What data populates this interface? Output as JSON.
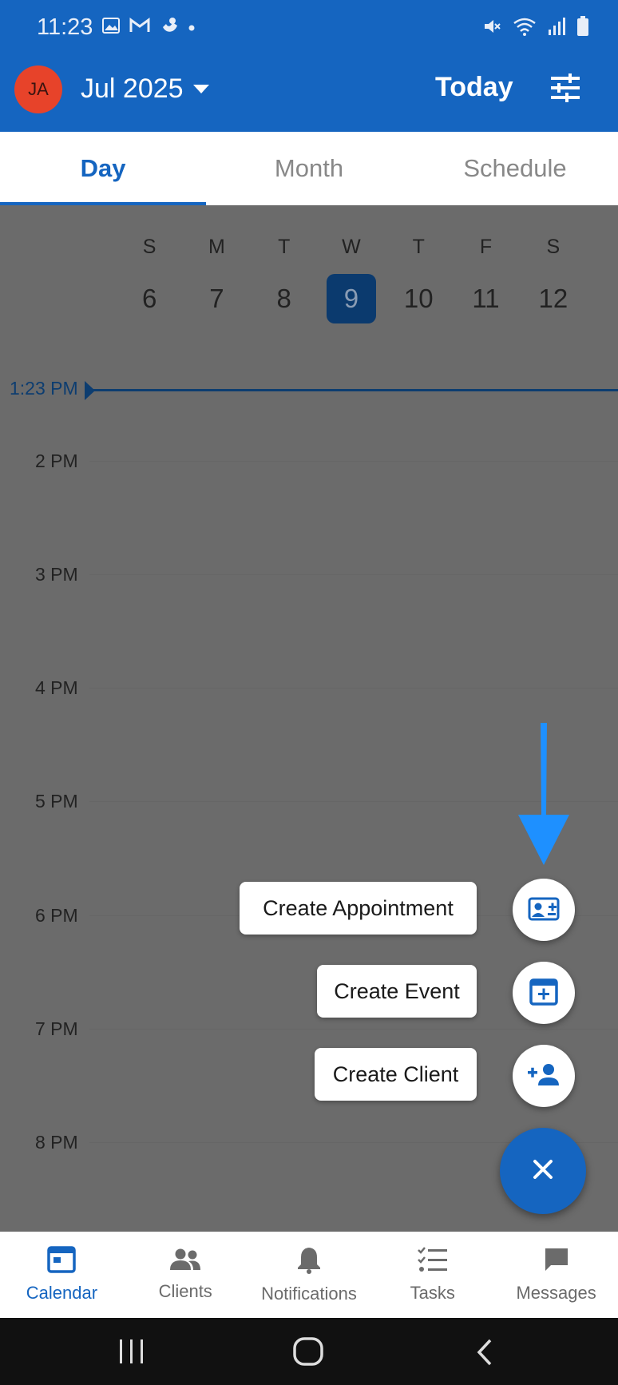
{
  "status_bar": {
    "time": "11:23",
    "left_icons": [
      "image-icon",
      "gmail-icon",
      "phone-icon",
      "dot-icon"
    ],
    "right_icons": [
      "mute-icon",
      "wifi-icon",
      "signal-icon",
      "battery-icon"
    ]
  },
  "header": {
    "avatar_initials": "JA",
    "month": "Jul 2025",
    "today_label": "Today",
    "filter_icon": "tune-icon",
    "accent_color": "#1565c0"
  },
  "tabs": [
    {
      "label": "Day",
      "active": true
    },
    {
      "label": "Month",
      "active": false
    },
    {
      "label": "Schedule",
      "active": false
    }
  ],
  "week": [
    {
      "letter": "S",
      "day": "6"
    },
    {
      "letter": "M",
      "day": "7"
    },
    {
      "letter": "T",
      "day": "8"
    },
    {
      "letter": "W",
      "day": "9",
      "selected": true
    },
    {
      "letter": "T",
      "day": "10"
    },
    {
      "letter": "F",
      "day": "11"
    },
    {
      "letter": "S",
      "day": "12"
    }
  ],
  "current_time_label": "1:23 PM",
  "hours": [
    "2 PM",
    "3 PM",
    "4 PM",
    "5 PM",
    "6 PM",
    "7 PM",
    "8 PM"
  ],
  "speed_dial": {
    "actions": [
      {
        "label": "Create Appointment",
        "icon": "appointment-add-icon"
      },
      {
        "label": "Create Event",
        "icon": "calendar-add-icon"
      },
      {
        "label": "Create Client",
        "icon": "person-add-icon"
      }
    ],
    "close_icon": "close-icon"
  },
  "bottom_nav": [
    {
      "label": "Calendar",
      "icon": "calendar-icon",
      "active": true
    },
    {
      "label": "Clients",
      "icon": "people-icon",
      "active": false
    },
    {
      "label": "Notifications",
      "icon": "bell-icon",
      "active": false
    },
    {
      "label": "Tasks",
      "icon": "checklist-icon",
      "active": false
    },
    {
      "label": "Messages",
      "icon": "chat-icon",
      "active": false
    }
  ],
  "system_nav": [
    "recents-icon",
    "home-icon",
    "back-icon"
  ]
}
